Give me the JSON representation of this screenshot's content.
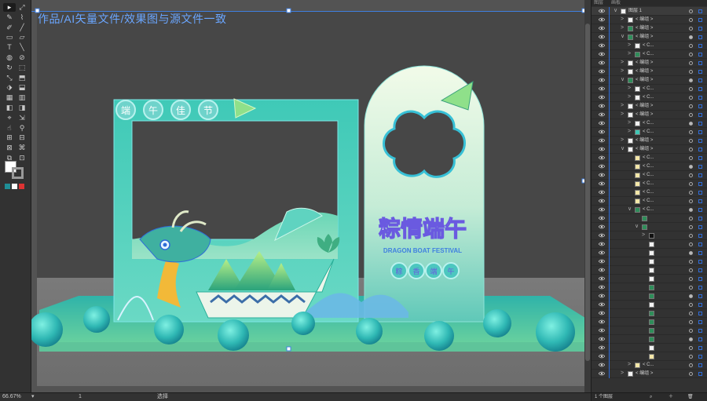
{
  "canvas": {
    "overlay_text": "作品/AI矢量文件/效果图与源文件一致"
  },
  "artwork": {
    "frame_title_chars": [
      "端",
      "午",
      "佳",
      "节"
    ],
    "main_title": "粽情端午",
    "subtitle": "DRAGON BOAT FESTIVAL",
    "badge_chars": [
      "粽",
      "香",
      "端",
      "午"
    ]
  },
  "statusbar": {
    "zoom": "66.67%",
    "artboard_number": "1",
    "tool_name": "选择"
  },
  "panel": {
    "tabs": [
      "图层",
      "画板"
    ],
    "footer": "1 个图层",
    "rows": [
      {
        "indent": 0,
        "chev": "∨",
        "name": "图层 1",
        "thumb": "white"
      },
      {
        "indent": 1,
        "chev": ">",
        "name": "< 编组 >",
        "thumb": "white"
      },
      {
        "indent": 1,
        "chev": ">",
        "name": "< 编组 >",
        "thumb": "green"
      },
      {
        "indent": 1,
        "chev": "∨",
        "name": "< 编组 >",
        "thumb": "green"
      },
      {
        "indent": 2,
        "chev": ">",
        "name": "< C...",
        "thumb": "white"
      },
      {
        "indent": 2,
        "chev": ">",
        "name": "< C...",
        "thumb": "green"
      },
      {
        "indent": 1,
        "chev": ">",
        "name": "< 编组 >",
        "thumb": "white"
      },
      {
        "indent": 1,
        "chev": ">",
        "name": "< 编组 >",
        "thumb": "white"
      },
      {
        "indent": 1,
        "chev": "∨",
        "name": "< 编组 >",
        "thumb": "green"
      },
      {
        "indent": 2,
        "chev": ">",
        "name": "< C...",
        "thumb": "white"
      },
      {
        "indent": 2,
        "chev": ">",
        "name": "< C...",
        "thumb": "white"
      },
      {
        "indent": 1,
        "chev": ">",
        "name": "< 编组 >",
        "thumb": "white"
      },
      {
        "indent": 1,
        "chev": ">",
        "name": "< 编组 >",
        "thumb": "white"
      },
      {
        "indent": 2,
        "chev": ">",
        "name": "< C...",
        "thumb": "white"
      },
      {
        "indent": 2,
        "chev": ">",
        "name": "< C...",
        "thumb": "teal"
      },
      {
        "indent": 1,
        "chev": ">",
        "name": "< 编组 >",
        "thumb": "white"
      },
      {
        "indent": 1,
        "chev": "∨",
        "name": "< 编组 >",
        "thumb": "white"
      },
      {
        "indent": 2,
        "chev": "",
        "name": "< C...",
        "thumb": "yellow"
      },
      {
        "indent": 2,
        "chev": "",
        "name": "< C...",
        "thumb": "yellow"
      },
      {
        "indent": 2,
        "chev": "",
        "name": "< C...",
        "thumb": "yellow"
      },
      {
        "indent": 2,
        "chev": "",
        "name": "< C...",
        "thumb": "yellow"
      },
      {
        "indent": 2,
        "chev": "",
        "name": "< C...",
        "thumb": "yellow"
      },
      {
        "indent": 2,
        "chev": "",
        "name": "< C...",
        "thumb": "yellow"
      },
      {
        "indent": 2,
        "chev": "∨",
        "name": "< C...",
        "thumb": "green"
      },
      {
        "indent": 3,
        "chev": "",
        "name": "",
        "thumb": "green"
      },
      {
        "indent": 3,
        "chev": "∨",
        "name": "",
        "thumb": "green"
      },
      {
        "indent": 4,
        "chev": ">",
        "name": "",
        "thumb": "black"
      },
      {
        "indent": 4,
        "chev": "",
        "name": "",
        "thumb": "white"
      },
      {
        "indent": 4,
        "chev": "",
        "name": "",
        "thumb": "white"
      },
      {
        "indent": 4,
        "chev": "",
        "name": "",
        "thumb": "white"
      },
      {
        "indent": 4,
        "chev": "",
        "name": "",
        "thumb": "white"
      },
      {
        "indent": 4,
        "chev": "",
        "name": "",
        "thumb": "white"
      },
      {
        "indent": 4,
        "chev": "",
        "name": "",
        "thumb": "green"
      },
      {
        "indent": 4,
        "chev": "",
        "name": "",
        "thumb": "green"
      },
      {
        "indent": 4,
        "chev": "",
        "name": "",
        "thumb": "white"
      },
      {
        "indent": 4,
        "chev": "",
        "name": "",
        "thumb": "green"
      },
      {
        "indent": 4,
        "chev": "",
        "name": "",
        "thumb": "green"
      },
      {
        "indent": 4,
        "chev": "",
        "name": "",
        "thumb": "green"
      },
      {
        "indent": 4,
        "chev": "",
        "name": "",
        "thumb": "green"
      },
      {
        "indent": 4,
        "chev": "",
        "name": "",
        "thumb": "white"
      },
      {
        "indent": 4,
        "chev": "",
        "name": "",
        "thumb": "yellow"
      },
      {
        "indent": 2,
        "chev": ">",
        "name": "< C...",
        "thumb": "yellow"
      },
      {
        "indent": 1,
        "chev": ">",
        "name": "< 编组 >",
        "thumb": "white"
      }
    ]
  },
  "colors": {
    "accent": "#2f6cd8",
    "teal": "#3fc7b5",
    "teal_dark": "#1f8e95",
    "mint": "#bfefd0",
    "purple_text": "#6a5ae0",
    "blue_text": "#3f7fe0"
  }
}
